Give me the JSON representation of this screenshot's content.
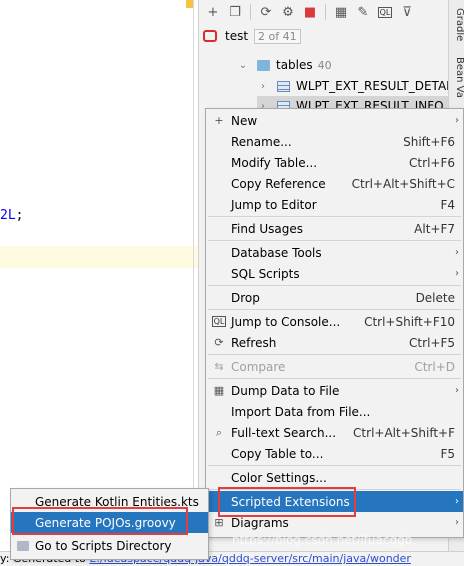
{
  "editor": {
    "code_fragment": "2L",
    "code_semicolon": ";"
  },
  "toolbar": {
    "icons": [
      "plus-icon",
      "copy-icon",
      "refresh-icon",
      "settings-icon",
      "stop-icon",
      "table-icon",
      "edit-icon",
      "console-icon",
      "filter-icon"
    ]
  },
  "tree": {
    "schema_name": "test",
    "schema_count": "2 of 41",
    "folder_name": "tables",
    "folder_count": "40",
    "table1": "WLPT_EXT_RESULT_DETAIL",
    "table2": "WLPT_EXT_RESULT_INFO"
  },
  "side_tabs": [
    "Gradle",
    "Bean Va"
  ],
  "context_menu": {
    "new": "New",
    "rename": "Rename...",
    "rename_sc": "Shift+F6",
    "modify_table": "Modify Table...",
    "modify_table_sc": "Ctrl+F6",
    "copy_reference": "Copy Reference",
    "copy_reference_sc": "Ctrl+Alt+Shift+C",
    "jump_to_editor": "Jump to Editor",
    "jump_to_editor_sc": "F4",
    "find_usages": "Find Usages",
    "find_usages_sc": "Alt+F7",
    "database_tools": "Database Tools",
    "sql_scripts": "SQL Scripts",
    "drop": "Drop",
    "drop_sc": "Delete",
    "jump_to_console": "Jump to Console...",
    "jump_to_console_sc": "Ctrl+Shift+F10",
    "refresh": "Refresh",
    "refresh_sc": "Ctrl+F5",
    "compare": "Compare",
    "compare_sc": "Ctrl+D",
    "dump_data": "Dump Data to File",
    "import_data": "Import Data from File...",
    "fulltext_search": "Full-text Search...",
    "fulltext_search_sc": "Ctrl+Alt+Shift+F",
    "copy_table_to": "Copy Table to...",
    "copy_table_to_sc": "F5",
    "color_settings": "Color Settings...",
    "scripted_extensions": "Scripted Extensions",
    "diagrams": "Diagrams"
  },
  "submenu": {
    "kotlin": "Generate Kotlin Entities.kts",
    "pojos": "Generate POJOs.groovy",
    "scripts_dir": "Go to Scripts Directory"
  },
  "status": {
    "prefix": "y: Generated to ",
    "path": "E:/ideaspace/qddq-java/qddq-server/src/main/java/wonder"
  },
  "watermark": "https://blog.csdn.net/lfuacggb",
  "colors": {
    "selection": "#2675bf",
    "highlight_box": "#e53c3c",
    "db_icon": "#d82d2d"
  }
}
